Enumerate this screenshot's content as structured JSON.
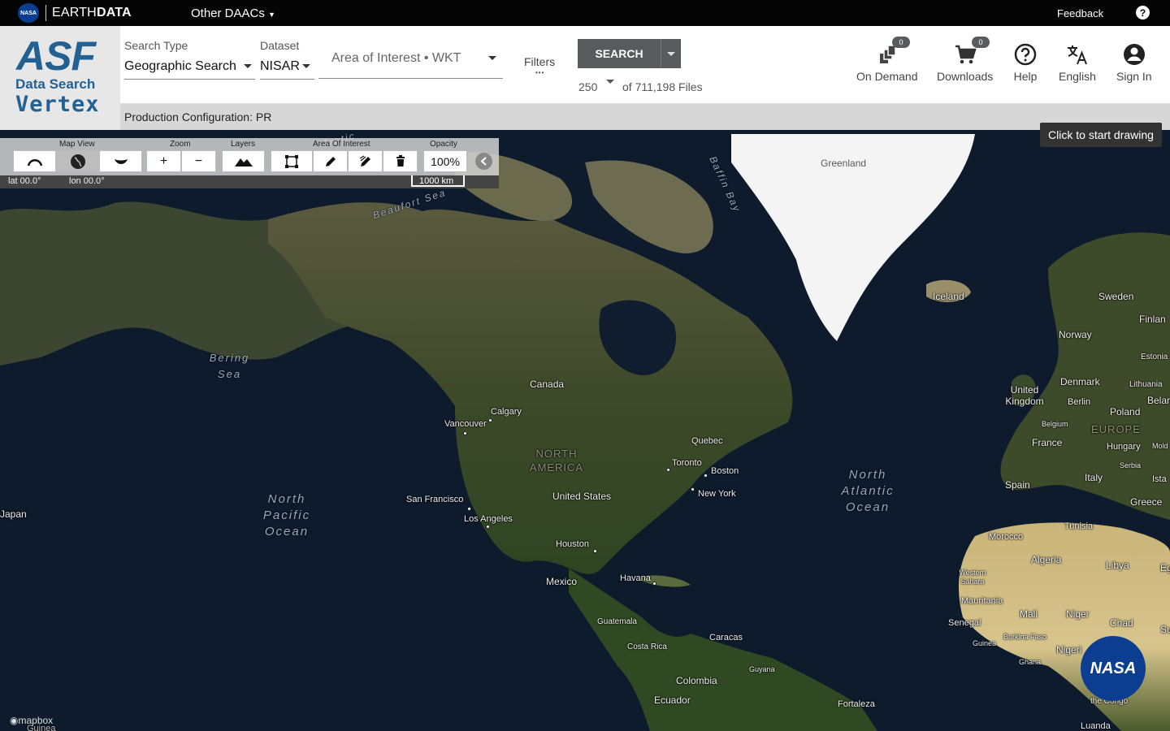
{
  "topbar": {
    "nasa_logo": "NASA",
    "brand_light": "EARTH",
    "brand_bold": "DATA",
    "other_daacs": "Other DAACs",
    "feedback": "Feedback",
    "help_glyph": "?"
  },
  "logo": {
    "asf": "ASF",
    "data_search": "Data Search",
    "vertex": "Vertex"
  },
  "search": {
    "search_type_label": "Search Type",
    "search_type_value": "Geographic Search",
    "dataset_label": "Dataset",
    "dataset_value": "NISAR",
    "aoi_placeholder": "Area of Interest • WKT",
    "filters_label": "Filters",
    "filters_dots": "•••",
    "search_button": "SEARCH",
    "max_results": "250",
    "file_count": "of 711,198 Files"
  },
  "tools": {
    "on_demand": {
      "label": "On Demand",
      "badge": "0"
    },
    "downloads": {
      "label": "Downloads",
      "badge": "0"
    },
    "help": "Help",
    "language": "English",
    "sign_in": "Sign In"
  },
  "production_config": "Production Configuration: PR",
  "map_controls": {
    "map_view_label": "Map View",
    "zoom_label": "Zoom",
    "layers_label": "Layers",
    "aoi_label": "Area Of Interest",
    "opacity_label": "Opacity",
    "zoom_in": "+",
    "zoom_out": "−",
    "opacity_value": "100%",
    "lat": "lat 00.0°",
    "lon": "lon 00.0°",
    "scale": "1000 km"
  },
  "tooltip": "Click to start drawing",
  "map_labels": {
    "greenland": "Greenland",
    "baffin_bay": "Baffin Bay",
    "beaufort_sea": "Beaufort Sea",
    "arctic": "Arctic",
    "iceland": "Iceland",
    "sweden": "Sweden",
    "finland": "Finlan",
    "norway": "Norway",
    "estonia": "Estonia",
    "bering_sea": "Bering Sea",
    "canada": "Canada",
    "calgary": "Calgary",
    "vancouver": "Vancouver",
    "united_kingdom": "United Kingdom",
    "denmark": "Denmark",
    "lithuania": "Lithuania",
    "belarus": "Belar",
    "berlin": "Berlin",
    "poland": "Poland",
    "belgium": "Belgium",
    "france": "France",
    "hungary": "Hungary",
    "moldova": "Mold",
    "serbia": "Serbia",
    "europe": "EUROPE",
    "north_america": "NORTH AMERICA",
    "quebec": "Quebec",
    "toronto": "Toronto",
    "boston": "Boston",
    "new_york": "New York",
    "north_atlantic": "North Atlantic Ocean",
    "north_pacific": "North Pacific Ocean",
    "japan": "Japan",
    "san_francisco": "San Francisco",
    "united_states": "United States",
    "los_angeles": "Los Angeles",
    "spain": "Spain",
    "italy": "Italy",
    "istanbul": "Ista",
    "greece": "Greece",
    "tunisia": "Tunisia",
    "morocco": "Morocco",
    "algeria": "Algeria",
    "libya": "Libya",
    "egypt": "Eg",
    "houston": "Houston",
    "mexico": "Mexico",
    "havana": "Havana",
    "western_sahara": "Western Sahara",
    "mauritania": "Mauritania",
    "mali": "Mali",
    "niger": "Niger",
    "chad": "Chad",
    "sudan": "Su",
    "senegal": "Senegal",
    "guinea": "Guinea",
    "burkina_faso": "Burkina Faso",
    "nigeria": "Nigeri",
    "ghana": "Ghana",
    "cameroon": "Ca",
    "guatemala": "Guatemala",
    "costa_rica": "Costa Rica",
    "caracas": "Caracas",
    "guyana": "Guyana",
    "colombia": "Colombia",
    "ecuador": "Ecuador",
    "fortaleza": "Fortaleza",
    "the_congo": "the Congo",
    "luanda": "Luanda",
    "guinea_bottom": "Guinea"
  },
  "nasa_badge": "NASA",
  "mapbox": "mapbox"
}
